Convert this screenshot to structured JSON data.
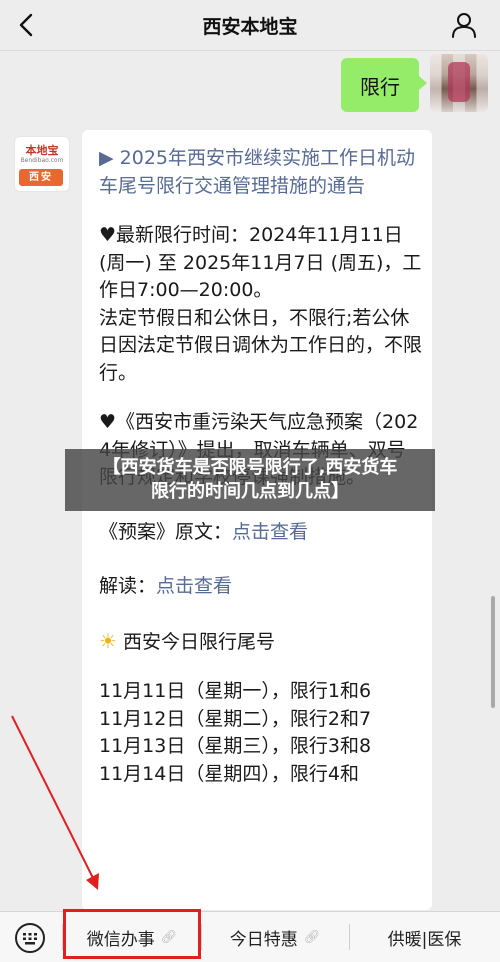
{
  "header": {
    "title": "西安本地宝",
    "back_icon": "chevron-left-icon",
    "profile_icon": "person-icon"
  },
  "chat": {
    "user_message": "限行",
    "bot_avatar": {
      "brand": "本地宝",
      "domain": "Bendibao.com",
      "city": "西安"
    },
    "reply": {
      "headline": "▶ 2025年西安市继续实施工作日机动车尾号限行交通管理措施的通告",
      "time_label": "♥最新限行时间：2024年11月11日 (周一) 至 2025年11月7日 (周五)，工作日7:00—20:00。",
      "holiday_text": "法定节假日和公休日，不限行;若公休日因法定节假日调休为工作日的，不限行。",
      "plan_text": "♥《西安市重污染天气应急预案（2024年修订）》提出，取消车辆单、双号限行规定和学校停课强制措施。",
      "plan_original_label": "《预案》原文：",
      "plan_original_link": "点击查看",
      "interpret_label": "解读：",
      "interpret_link": "点击查看",
      "today_title": "西安今日限行尾号",
      "schedule": [
        "11月11日（星期一），限行1和6",
        "11月12日（星期二），限行2和7",
        "11月13日（星期三），限行3和8",
        "11月14日（星期四），限行4和"
      ]
    }
  },
  "overlay": {
    "line1": "【西安货车是否限号限行了,西安货车",
    "line2": "限行的时间几点到几点】"
  },
  "bottom_menu": {
    "keyboard_icon": "keyboard-icon",
    "items": [
      {
        "label": "微信办事"
      },
      {
        "label": "今日特惠"
      },
      {
        "label": "供暖|医保"
      }
    ],
    "link_icon": "link-icon"
  },
  "colors": {
    "user_bubble": "#95ec69",
    "link": "#576b95",
    "annotation": "#e02020",
    "page_bg": "#ededed"
  }
}
